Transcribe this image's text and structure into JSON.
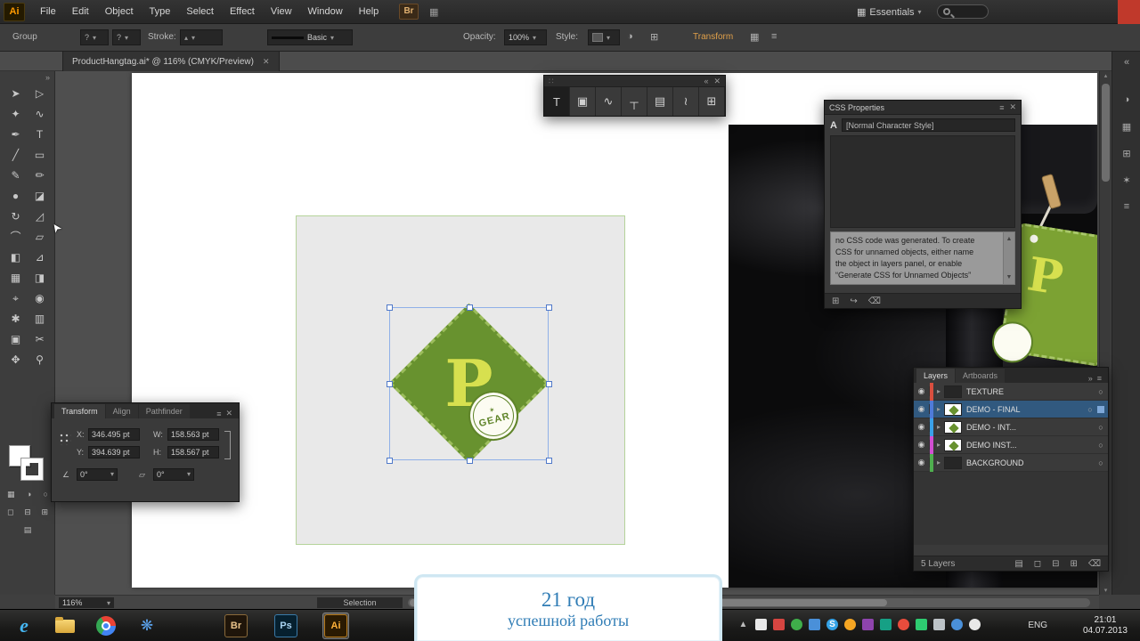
{
  "colors": {
    "accent_orange": "#ff9a00",
    "selection_blue": "#8fb0e8",
    "layer_selected_bg": "#31597f",
    "logo_green": "#68922f",
    "logo_letter_green": "#d7e04f",
    "overlay_text_blue": "#2f7cb5",
    "layer_colors": [
      "#d94f3f",
      "#4f7bd9",
      "#3aa0e8",
      "#d24fd2",
      "#4fae4f"
    ]
  },
  "icons": {
    "caret_down": "▾",
    "caret_up": "▴",
    "close": "✕",
    "collapse_left": "«",
    "collapse_right": "»",
    "panel_menu": "≡",
    "grip": "∷",
    "workspace_grid": "▦",
    "expand": "▸",
    "eye": "◉",
    "target": "○",
    "scroll_up": "▲",
    "scroll_down": "▼",
    "angle": "∠",
    "shear": "▱",
    "halftone": "◑",
    "doc_grid": "⊞",
    "question": "?",
    "star": "✶",
    "css_code": "⊞",
    "css_export": "↪",
    "css_trash": "⌫",
    "lyr_mask": "◻",
    "lyr_sublayer": "⊟",
    "lyr_new": "⊞",
    "lyr_trash": "⌫",
    "lyr_flatten": "▤",
    "tray_arrow": "▲"
  },
  "menubar": {
    "logo": "Ai",
    "items": [
      "File",
      "Edit",
      "Object",
      "Type",
      "Select",
      "Effect",
      "View",
      "Window",
      "Help"
    ],
    "bridge_button": "Br",
    "workspace": "Essentials"
  },
  "controlbar": {
    "group_label": "Group",
    "stroke_label": "Stroke:",
    "brush_name": "Basic",
    "opacity_label": "Opacity:",
    "opacity_value": "100%",
    "style_label": "Style:",
    "transform_link": "Transform"
  },
  "document": {
    "tab_title": "ProductHangtag.ai* @ 116% (CMYK/Preview)",
    "zoom": "116%",
    "status_tool": "Selection"
  },
  "toolbar": {
    "tools": [
      {
        "name": "selection-tool",
        "glyph": "➤"
      },
      {
        "name": "direct-selection-tool",
        "glyph": "▷"
      },
      {
        "name": "magic-wand-tool",
        "glyph": "✦"
      },
      {
        "name": "lasso-tool",
        "glyph": "∿"
      },
      {
        "name": "pen-tool",
        "glyph": "✒"
      },
      {
        "name": "type-tool",
        "glyph": "T"
      },
      {
        "name": "line-tool",
        "glyph": "╱"
      },
      {
        "name": "rectangle-tool",
        "glyph": "▭"
      },
      {
        "name": "paintbrush-tool",
        "glyph": "✎"
      },
      {
        "name": "pencil-tool",
        "glyph": "✏"
      },
      {
        "name": "blob-brush-tool",
        "glyph": "●"
      },
      {
        "name": "eraser-tool",
        "glyph": "◪"
      },
      {
        "name": "rotate-tool",
        "glyph": "↻"
      },
      {
        "name": "scale-tool",
        "glyph": "◿"
      },
      {
        "name": "width-tool",
        "glyph": "⌒"
      },
      {
        "name": "free-transform-tool",
        "glyph": "▱"
      },
      {
        "name": "shape-builder-tool",
        "glyph": "◧"
      },
      {
        "name": "perspective-grid-tool",
        "glyph": "⊿"
      },
      {
        "name": "mesh-tool",
        "glyph": "▦"
      },
      {
        "name": "gradient-tool",
        "glyph": "◨"
      },
      {
        "name": "eyedropper-tool",
        "glyph": "⌖"
      },
      {
        "name": "blend-tool",
        "glyph": "◉"
      },
      {
        "name": "symbol-sprayer-tool",
        "glyph": "✱"
      },
      {
        "name": "graph-tool",
        "glyph": "▥"
      },
      {
        "name": "artboard-tool",
        "glyph": "▣"
      },
      {
        "name": "slice-tool",
        "glyph": "✂"
      },
      {
        "name": "hand-tool",
        "glyph": "✥"
      },
      {
        "name": "zoom-tool",
        "glyph": "⚲"
      }
    ]
  },
  "type_toolbar": {
    "tools": [
      {
        "name": "type-tool",
        "glyph": "T"
      },
      {
        "name": "area-type-tool",
        "glyph": "▣"
      },
      {
        "name": "type-on-path-tool",
        "glyph": "∿"
      },
      {
        "name": "vertical-type-tool",
        "glyph": "┬"
      },
      {
        "name": "vertical-area-type-tool",
        "glyph": "▤"
      },
      {
        "name": "vertical-type-on-path-tool",
        "glyph": "≀"
      },
      {
        "name": "touch-type-tool",
        "glyph": "⊞"
      }
    ]
  },
  "artwork": {
    "letter": "P",
    "badge_text": "GEAR",
    "tag_letter": "P"
  },
  "css_panel": {
    "title": "CSS Properties",
    "char_style_icon": "A",
    "char_style": "[Normal Character Style]",
    "message_lines": [
      "no CSS code was generated. To create",
      "CSS for unnamed objects, either name",
      "the object in layers panel, or enable",
      "“Generate CSS for Unnamed Objects”"
    ]
  },
  "transform_panel": {
    "tabs": [
      "Transform",
      "Align",
      "Pathfinder"
    ],
    "fields": {
      "x_label": "X:",
      "x_value": "346.495 pt",
      "y_label": "Y:",
      "y_value": "394.639 pt",
      "w_label": "W:",
      "w_value": "158.563 pt",
      "h_label": "H:",
      "h_value": "158.567 pt",
      "rotate_value": "0°",
      "shear_value": "0°"
    }
  },
  "layers_panel": {
    "tabs": [
      "Layers",
      "Artboards"
    ],
    "layers": [
      {
        "name": "TEXTURE"
      },
      {
        "name": "DEMO - FINAL"
      },
      {
        "name": "DEMO - INT..."
      },
      {
        "name": "DEMO INST..."
      },
      {
        "name": "BACKGROUND"
      }
    ],
    "count_label": "5 Layers"
  },
  "taskbar": {
    "apps": [
      {
        "name": "internet-explorer",
        "label": "e"
      },
      {
        "name": "bridge",
        "label": "Br"
      },
      {
        "name": "photoshop",
        "label": "Ps"
      },
      {
        "name": "illustrator",
        "label": "Ai"
      }
    ],
    "language": "ENG",
    "time": "21:01",
    "date": "04.07.2013"
  },
  "overlay": {
    "line1": "21 год",
    "line2": "успешной работы"
  }
}
